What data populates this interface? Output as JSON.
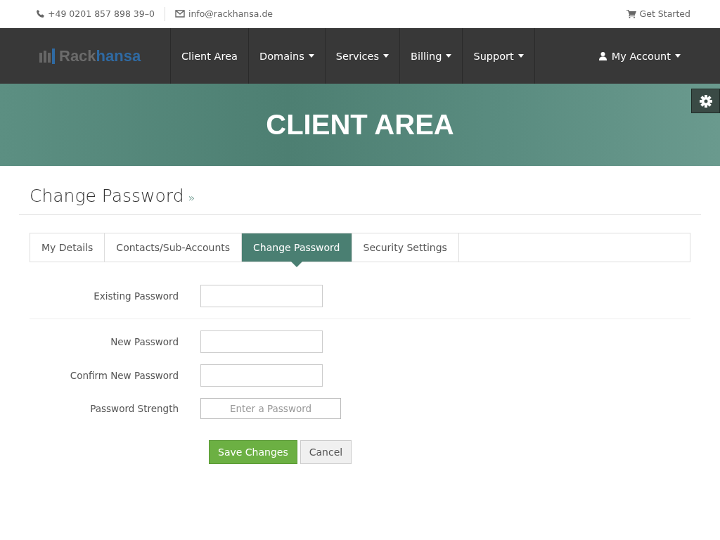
{
  "topbar": {
    "phone": "+49 0201 857 898 39–0",
    "email": "info@rackhansa.de",
    "cart_link": "Get Started"
  },
  "logo": {
    "part_1": "Rack",
    "part_2": "hansa"
  },
  "nav": [
    {
      "label": "Client Area",
      "dropdown": false
    },
    {
      "label": "Domains",
      "dropdown": true
    },
    {
      "label": "Services",
      "dropdown": true
    },
    {
      "label": "Billing",
      "dropdown": true
    },
    {
      "label": "Support",
      "dropdown": true
    }
  ],
  "account": {
    "label": "My Account",
    "dropdown": true
  },
  "hero": {
    "title": "CLIENT AREA"
  },
  "page_title": {
    "text": "Change Password",
    "mark": "»"
  },
  "tabs": [
    {
      "label": "My Details",
      "selected": false
    },
    {
      "label": "Contacts/Sub-Accounts",
      "selected": false
    },
    {
      "label": "Change Password",
      "selected": true
    },
    {
      "label": "Security Settings",
      "selected": false
    }
  ],
  "fields": [
    {
      "kind": "password",
      "label": "Existing Password",
      "divider_after": true
    },
    {
      "kind": "password",
      "label": "New Password",
      "divider_after": false
    },
    {
      "kind": "password",
      "label": "Confirm New Password",
      "divider_after": false
    },
    {
      "kind": "strength",
      "label": "Password Strength",
      "meter_text": "Enter a Password",
      "level": 0,
      "divider_after": false
    }
  ],
  "buttons": [
    {
      "label": "Save Changes",
      "kind": "primary"
    },
    {
      "label": "Cancel",
      "kind": "default"
    }
  ]
}
